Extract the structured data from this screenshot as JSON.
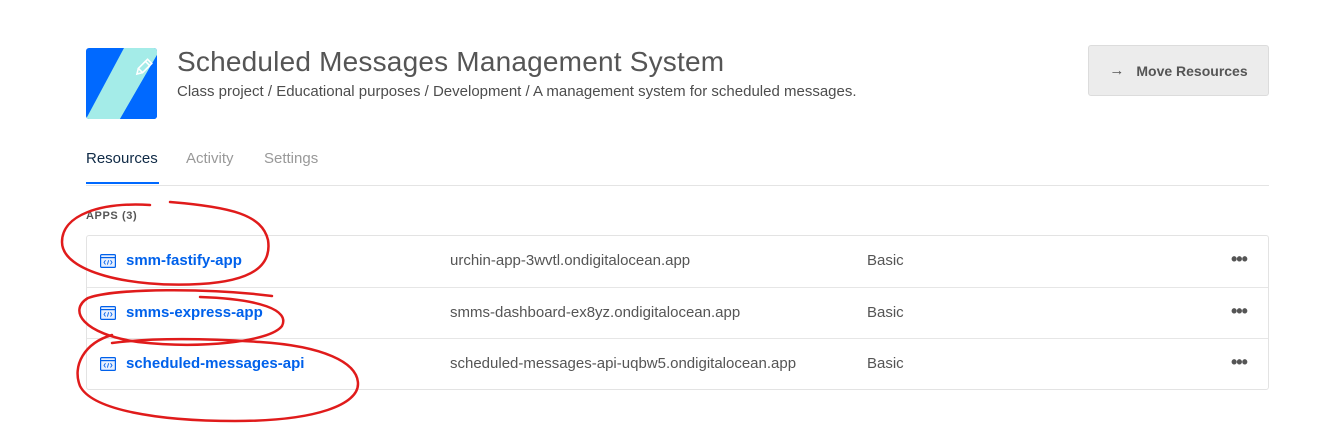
{
  "project": {
    "title": "Scheduled Messages Management System",
    "description": "Class project / Educational purposes / Development / A management system for scheduled messages.",
    "icon": "pencil-icon",
    "colors": {
      "blue": "#0069ff",
      "cyan": "#a4ece8"
    }
  },
  "header": {
    "move_button_label": "Move Resources",
    "move_button_icon": "arrow-right-icon"
  },
  "tabs": [
    {
      "label": "Resources",
      "active": true
    },
    {
      "label": "Activity",
      "active": false
    },
    {
      "label": "Settings",
      "active": false
    }
  ],
  "apps": {
    "section_label": "APPS (3)",
    "rows": [
      {
        "name": "smm-fastify-app",
        "url": "urchin-app-3wvtl.ondigitalocean.app",
        "tier": "Basic",
        "more": "•••"
      },
      {
        "name": "smms-express-app",
        "url": "smms-dashboard-ex8yz.ondigitalocean.app",
        "tier": "Basic",
        "more": "•••"
      },
      {
        "name": "scheduled-messages-api",
        "url": "scheduled-messages-api-uqbw5.ondigitalocean.app",
        "tier": "Basic",
        "more": "•••"
      }
    ]
  },
  "colors": {
    "link": "#0061eb",
    "annotation": "#e01b1b",
    "active_tab": "#0f2a46",
    "tab_underline": "#0069ff"
  }
}
